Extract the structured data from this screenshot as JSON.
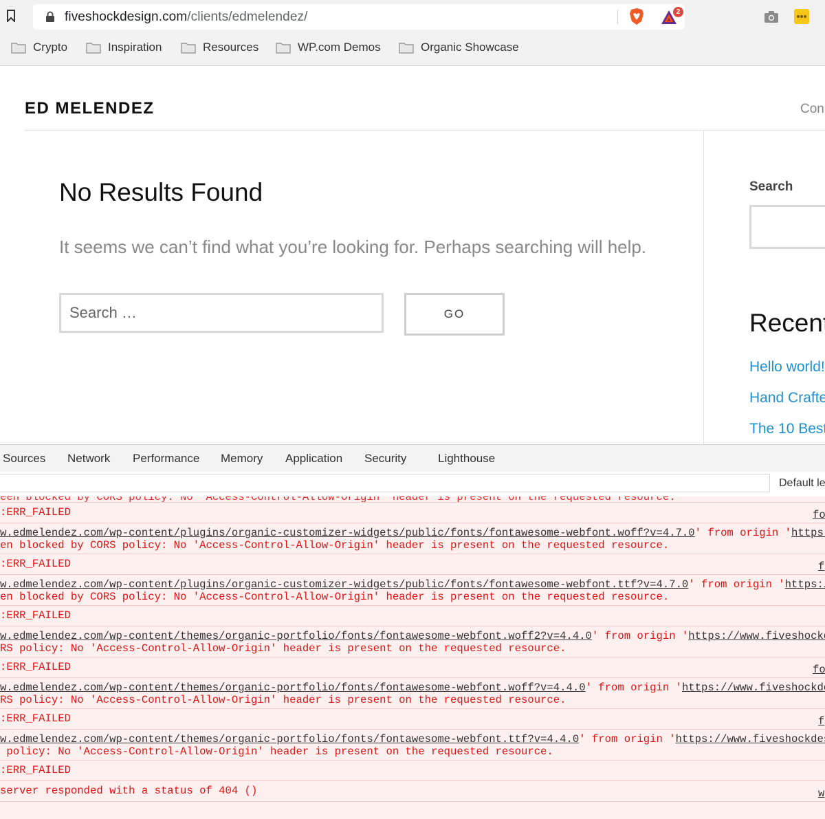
{
  "browser": {
    "url_host": "fiveshockdesign.com",
    "url_path": "/clients/edmelendez/",
    "bat_badge_count": "2",
    "bookmarks": [
      "Crypto",
      "Inspiration",
      "Resources",
      "WP.com Demos",
      "Organic Showcase"
    ]
  },
  "site": {
    "title": "ED MELENDEZ",
    "nav_partial": "Con"
  },
  "content": {
    "heading": "No Results Found",
    "message": "It seems we can’t find what you’re looking for. Perhaps searching will help.",
    "search_placeholder": "Search …",
    "go_label": "GO"
  },
  "sidebar": {
    "search_title": "Search",
    "recent_title": "Recent",
    "recent_links": [
      "Hello world!",
      "Hand Crafted",
      "The 10 Best"
    ]
  },
  "devtools": {
    "tabs": [
      "Sources",
      "Network",
      "Performance",
      "Memory",
      "Application",
      "Security",
      "Lighthouse"
    ],
    "levels_label": "Default le",
    "log": {
      "top_cut": "een blocked by CORS policy: No 'Access-Control-Allow-Origin' header is present on the requested resource.",
      "err": ":ERR_FAILED",
      "e1_url": "w.edmelendez.com/wp-content/plugins/organic-customizer-widgets/public/fonts/fontawesome-webfont.woff?v=4.7.0",
      "e1_mid": "' from origin '",
      "e1_origin": "https://w",
      "e1_msg": "en blocked by CORS policy: No 'Access-Control-Allow-Origin' header is present on the requested resource.",
      "e2_url": "w.edmelendez.com/wp-content/plugins/organic-customizer-widgets/public/fonts/fontawesome-webfont.ttf?v=4.7.0",
      "e2_mid": "' from origin '",
      "e2_origin": "https://ww",
      "e2_msg": "en blocked by CORS policy: No 'Access-Control-Allow-Origin' header is present on the requested resource.",
      "e3_url": "w.edmelendez.com/wp-content/themes/organic-portfolio/fonts/fontawesome-webfont.woff2?v=4.4.0",
      "e3_mid": "' from origin '",
      "e3_origin": "https://www.fiveshockdesi",
      "e3_msg": "RS policy: No 'Access-Control-Allow-Origin' header is present on the requested resource.",
      "e4_url": "w.edmelendez.com/wp-content/themes/organic-portfolio/fonts/fontawesome-webfont.woff?v=4.4.0",
      "e4_mid": "' from origin '",
      "e4_origin": "https://www.fiveshockdesig",
      "e4_msg": "RS policy: No 'Access-Control-Allow-Origin' header is present on the requested resource.",
      "e5_url": "w.edmelendez.com/wp-content/themes/organic-portfolio/fonts/fontawesome-webfont.ttf?v=4.4.0",
      "e5_mid": "' from origin '",
      "e5_origin": "https://www.fiveshockdesign",
      "e5_msg": " policy: No 'Access-Control-Allow-Origin' header is present on the requested resource.",
      "e6_msg": "server responded with a status of 404 ()",
      "src1": "fo",
      "src2": "f",
      "src3": "fo",
      "src4": "f",
      "src5": "w"
    }
  }
}
